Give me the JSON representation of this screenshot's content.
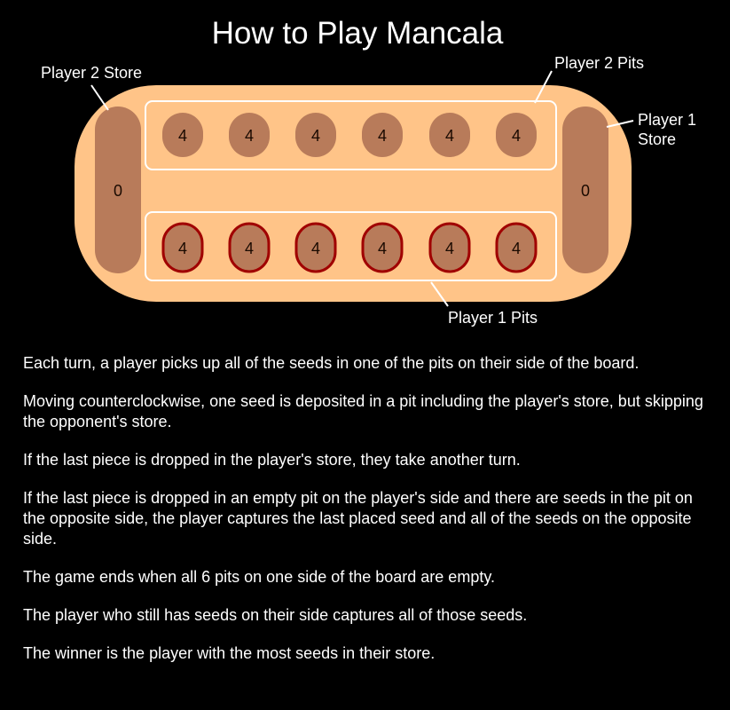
{
  "title": "How to Play Mancala",
  "labels": {
    "player2_store": "Player 2 Store",
    "player2_pits": "Player 2 Pits",
    "player1_store": "Player 1 Store",
    "player1_pits": "Player 1 Pits"
  },
  "board": {
    "player2_store": "0",
    "player1_store": "0",
    "player2_pits": [
      "4",
      "4",
      "4",
      "4",
      "4",
      "4"
    ],
    "player1_pits": [
      "4",
      "4",
      "4",
      "4",
      "4",
      "4"
    ]
  },
  "colors": {
    "board": "#ffc488",
    "pit": "#b87b5a",
    "player1_pit_border": "#a00000",
    "background": "#000000",
    "text": "#ffffff"
  },
  "instructions": [
    "Each turn, a player picks up all of the seeds in one of the pits on their side of the board.",
    "Moving counterclockwise, one seed is deposited in a pit including the player's store, but skipping the opponent's store.",
    "If the last piece is dropped in the player's store, they take another turn.",
    "If the last piece is dropped in an empty pit on the player's side and there are seeds in the pit on the opposite side, the player captures the last placed seed and all of the seeds on the opposite side.",
    "The game ends when all 6 pits on one side of the board are empty.",
    "The player who still has seeds on their side captures all of those seeds.",
    "The winner is the player with the most seeds in their store."
  ]
}
